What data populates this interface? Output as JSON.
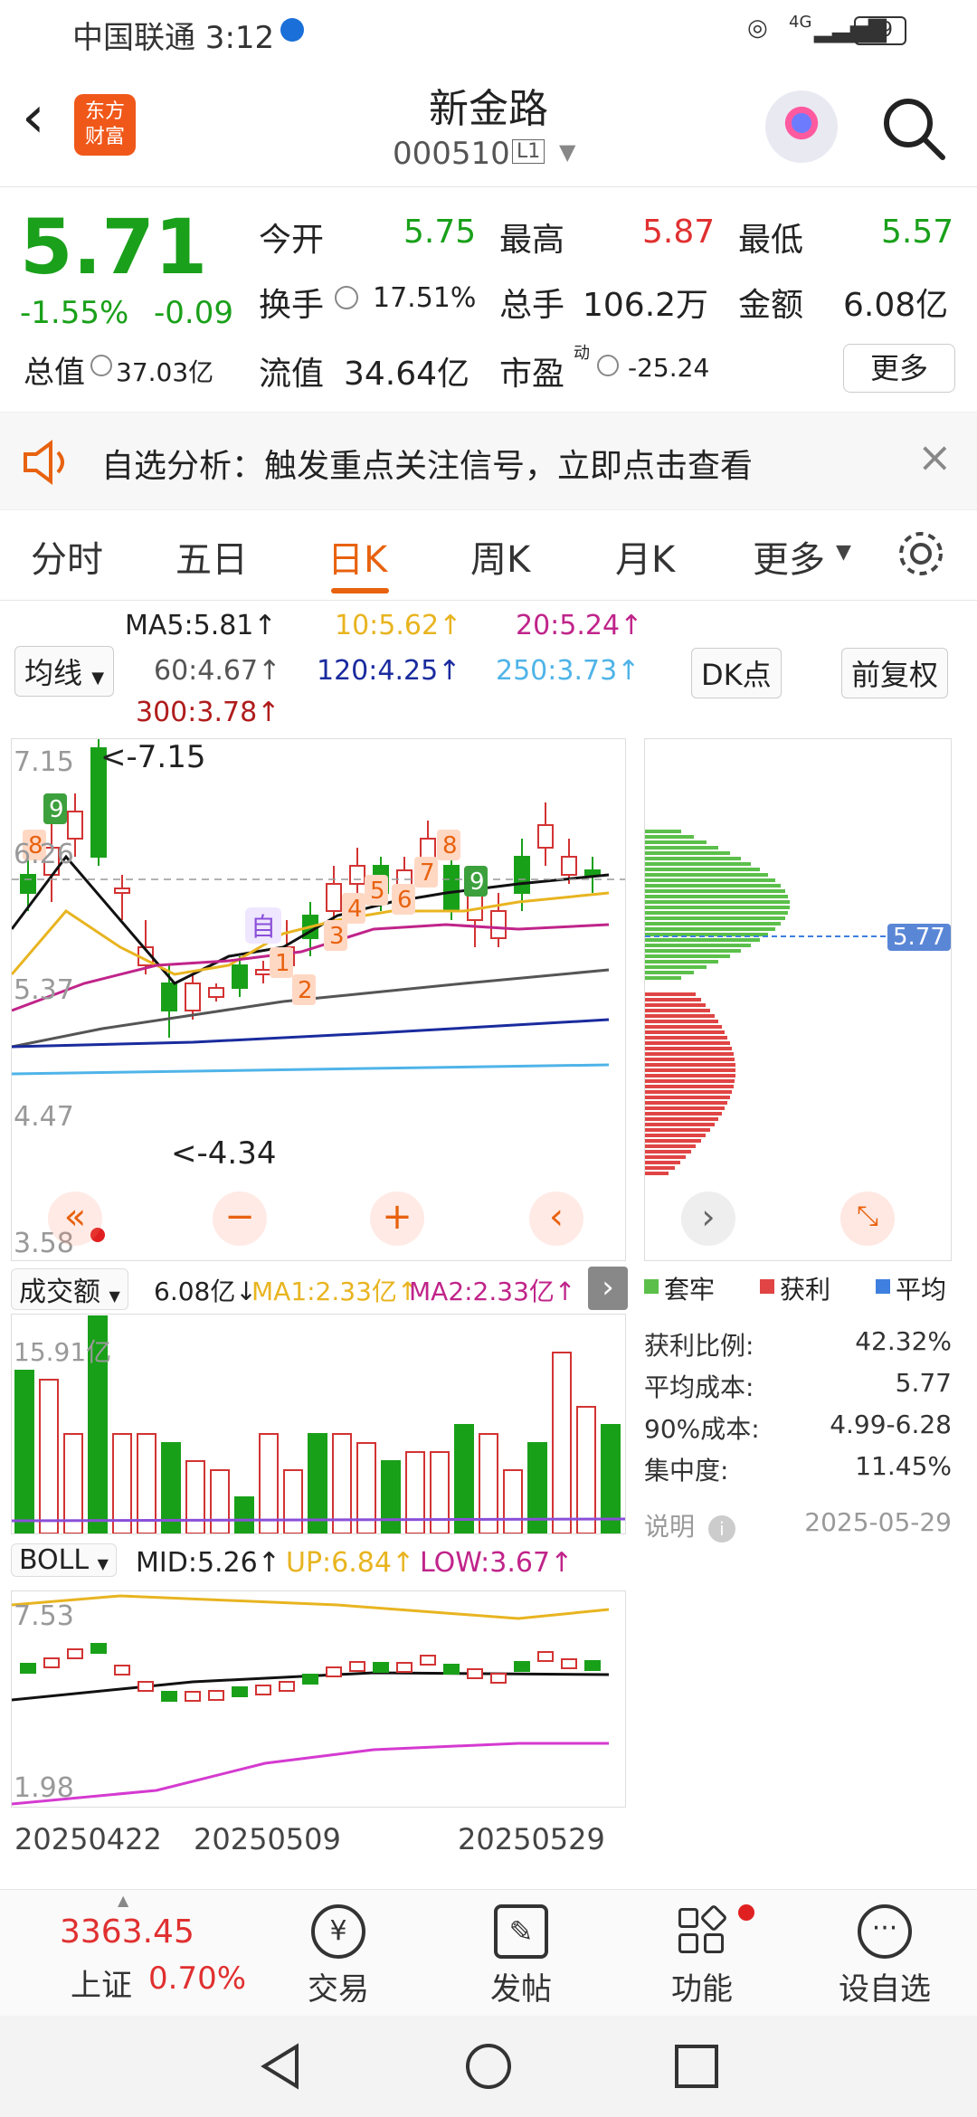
{
  "status_bar": {
    "carrier_time": "中国联通 3:12",
    "network": "4G",
    "battery": "99"
  },
  "header": {
    "name": "新金路",
    "code": "000510",
    "market_badge": "L1",
    "logo_text": "东方\n财富"
  },
  "quote": {
    "price": "5.71",
    "change_pct": "-1.55%",
    "change": "-0.09",
    "open_label": "今开",
    "open": "5.75",
    "high_label": "最高",
    "high": "5.87",
    "low_label": "最低",
    "low": "5.57",
    "turnover_label": "换手",
    "turnover": "17.51%",
    "volume_label": "总手",
    "volume": "106.2万",
    "amount_label": "金额",
    "amount": "6.08亿",
    "total_value_label": "总值",
    "total_value": "37.03亿",
    "float_value_label": "流值",
    "float_value": "34.64亿",
    "pe_label": "市盈",
    "pe_sup": "动",
    "pe": "-25.24",
    "more_button": "更多"
  },
  "banner": {
    "text": "自选分析：触发重点关注信号，立即点击查看"
  },
  "tabs": [
    "分时",
    "五日",
    "日K",
    "周K",
    "月K",
    "更多"
  ],
  "ma_bar": {
    "selector": "均线",
    "ma5": "MA5:5.81↑",
    "ma10": "10:5.62↑",
    "ma20": "20:5.24↑",
    "ma60": "60:4.67↑",
    "ma120": "120:4.25↑",
    "ma250": "250:3.73↑",
    "ma300": "300:3.78↑",
    "dk_button": "DK点",
    "adjust_button": "前复权"
  },
  "kchart": {
    "y_labels": [
      "7.15",
      "6.26",
      "5.37",
      "4.47",
      "3.58"
    ],
    "high_marker": "<-7.15",
    "low_marker": "<-4.34",
    "self_tag": "自",
    "num_tags": [
      "1",
      "2",
      "3",
      "4",
      "5",
      "6",
      "7",
      "8",
      "9",
      "8",
      "9"
    ],
    "controls": [
      "«",
      "−",
      "+",
      "‹"
    ],
    "colors": {
      "up": "#d33333",
      "down": "#19a019",
      "ma5": "#111111",
      "ma10": "#e8b420",
      "ma20": "#c0248a",
      "ma60": "#555555",
      "ma120": "#1a2b9e",
      "ma250": "#4fb4e8"
    }
  },
  "chip_panel": {
    "price_tag": "5.77",
    "legend": [
      "套牢",
      "获利",
      "平均"
    ],
    "stats": [
      {
        "label": "获利比例:",
        "value": "42.32%"
      },
      {
        "label": "平均成本:",
        "value": "5.77"
      },
      {
        "label": "90%成本:",
        "value": "4.99-6.28"
      },
      {
        "label": "集中度:",
        "value": "11.45%"
      }
    ],
    "note_label": "说明",
    "date": "2025-05-29"
  },
  "volume": {
    "selector": "成交额",
    "value": "6.08亿↓",
    "ma1": "MA1:2.33亿↑",
    "ma2": "MA2:2.33亿↑",
    "max_label": "15.91亿"
  },
  "boll": {
    "selector": "BOLL",
    "mid": "MID:5.26↑",
    "up": "UP:6.84↑",
    "low": "LOW:3.67↑",
    "top_label": "7.53",
    "bottom_label": "1.98"
  },
  "dates": [
    "20250422",
    "20250509",
    "20250529"
  ],
  "bottom_nav": {
    "index_value": "3363.45",
    "index_name": "上证",
    "index_change": "0.70%",
    "items": [
      "交易",
      "发帖",
      "功能",
      "设自选"
    ]
  }
}
